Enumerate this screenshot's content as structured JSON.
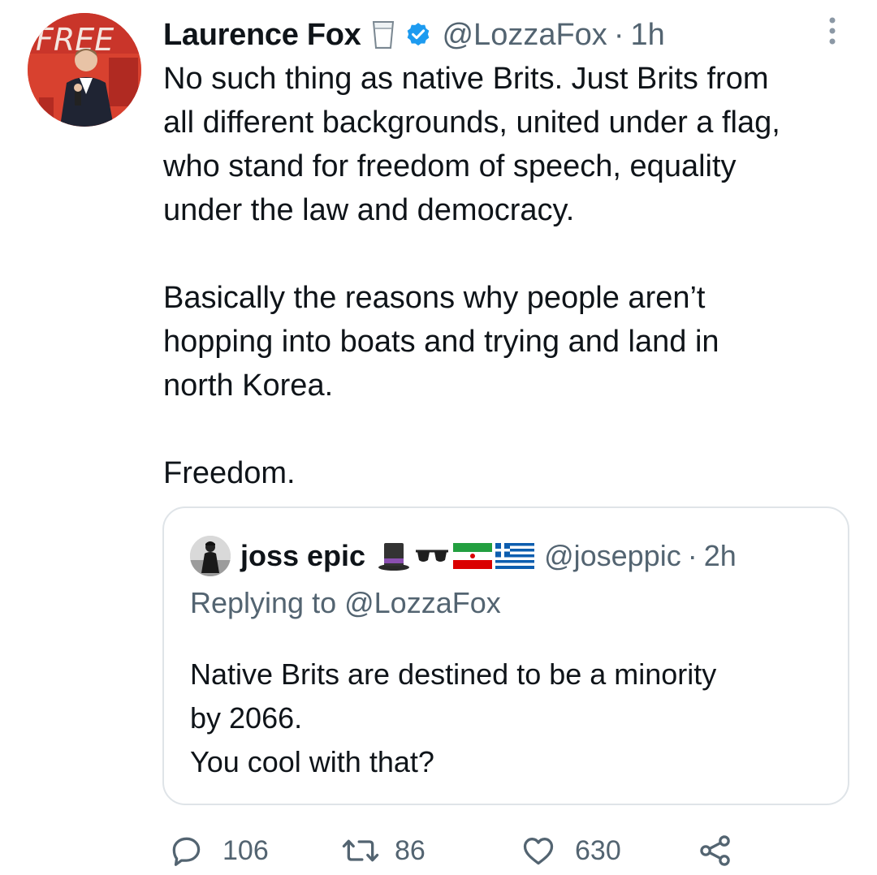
{
  "tweet": {
    "author_name": "Laurence Fox",
    "handle": "@LozzaFox",
    "separator": "·",
    "time": "1h",
    "text": "No such thing as native Brits. Just Brits from\nall different backgrounds, united under a flag,\nwho stand for freedom of speech, equality\nunder the law and democracy.\n\nBasically the reasons why people aren’t\nhopping into boats and trying and land in\nnorth Korea.\n\nFreedom.",
    "avatar_sign_text": "FREE",
    "icons": {
      "name_emoji": "glass-of-milk-icon",
      "verified": "verified-badge-icon",
      "more": "more-options-icon"
    }
  },
  "quoted_tweet": {
    "author_name": "joss epic",
    "name_emojis": [
      "top-hat-icon",
      "sunglasses-icon",
      "iran-flag-icon",
      "greece-flag-icon"
    ],
    "handle": "@joseppic",
    "separator": "·",
    "time": "2h",
    "replying_to": "Replying to @LozzaFox",
    "text": "Native Brits are destined to be a minority\nby 2066.\nYou cool with that?"
  },
  "actions": {
    "reply_count": "106",
    "retweet_count": "86",
    "like_count": "630",
    "icons": [
      "reply-icon",
      "retweet-icon",
      "like-icon",
      "share-icon"
    ]
  },
  "colors": {
    "text_primary": "#0f1419",
    "text_secondary": "#536471",
    "verified_blue": "#1d9bf0",
    "border": "#dfe4e8"
  }
}
